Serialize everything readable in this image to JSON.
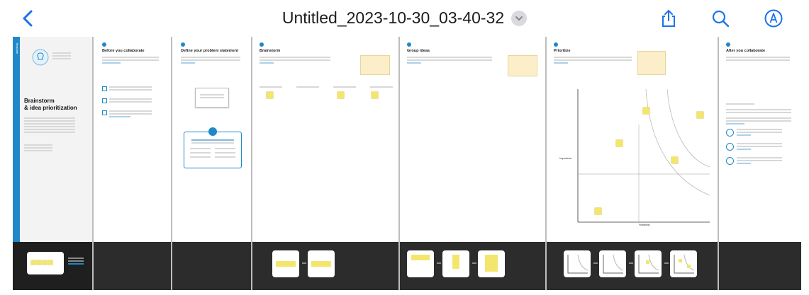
{
  "app": {
    "accent": "#1a73e8",
    "board_accent": "#1e88c8"
  },
  "toolbar": {
    "title": "Untitled_2023-10-30_03-40-32",
    "back_icon": "chevron-left-icon",
    "title_menu_icon": "chevron-down-icon",
    "share_icon": "share-icon",
    "search_icon": "search-icon",
    "markup_icon": "pencil-tip-circle-icon"
  },
  "cover": {
    "side_tab": "Template",
    "title_line1": "Brainstorm",
    "title_line2": "& idea prioritization"
  },
  "frames": [
    {
      "heading": "Before you collaborate"
    },
    {
      "heading": "Define your problem statement"
    },
    {
      "heading": "Brainstorm"
    },
    {
      "heading": "Group ideas"
    },
    {
      "heading": "Prioritize"
    },
    {
      "heading": "After you collaborate"
    }
  ],
  "chart": {
    "ylabel": "Importance",
    "xlabel": "Feasibility"
  }
}
